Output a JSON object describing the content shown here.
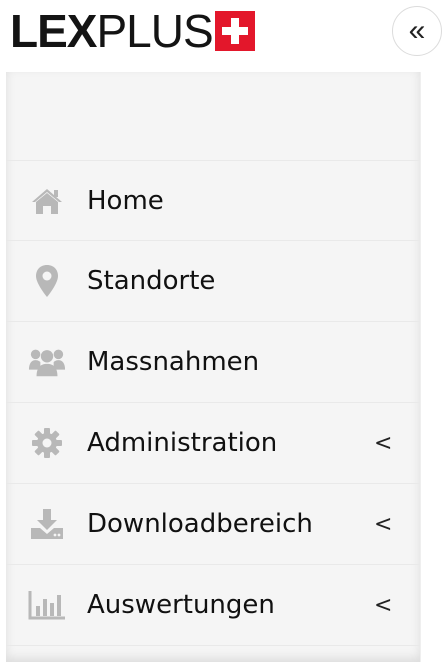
{
  "header": {
    "logo_bold": "LEX",
    "logo_light": "PLUS",
    "collapse_label": "«"
  },
  "colors": {
    "brand_red": "#e3172b",
    "icon_gray": "#b8b8b8",
    "sidebar_bg": "#f5f5f5"
  },
  "sidebar": {
    "items": [
      {
        "label": "Home",
        "icon": "home-icon",
        "chevron": ""
      },
      {
        "label": "Standorte",
        "icon": "map-marker-icon",
        "chevron": ""
      },
      {
        "label": "Massnahmen",
        "icon": "users-icon",
        "chevron": ""
      },
      {
        "label": "Administration",
        "icon": "gear-icon",
        "chevron": "<"
      },
      {
        "label": "Downloadbereich",
        "icon": "download-icon",
        "chevron": "<"
      },
      {
        "label": "Auswertungen",
        "icon": "bar-chart-icon",
        "chevron": "<"
      }
    ]
  }
}
